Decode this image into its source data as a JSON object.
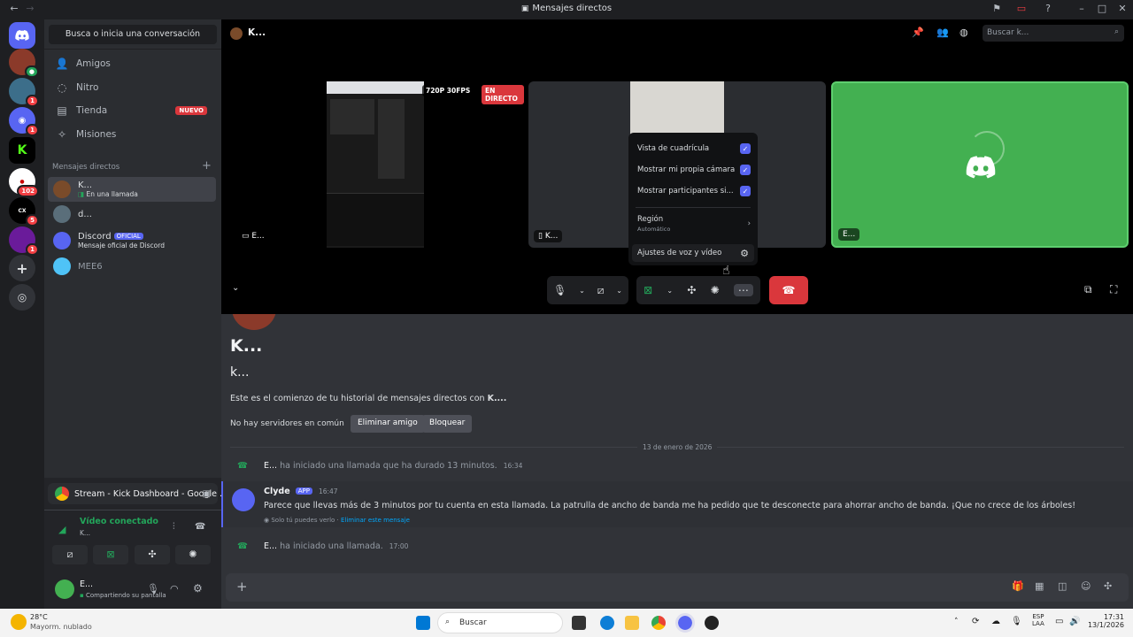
{
  "titlebar": {
    "title": "Mensajes directos"
  },
  "channels": {
    "search_label": "Busca o inicia una conversación",
    "nav": [
      {
        "label": "Amigos",
        "icon": "friends-icon"
      },
      {
        "label": "Nitro",
        "icon": "nitro-icon"
      },
      {
        "label": "Tienda",
        "icon": "shop-icon",
        "badge": "NUEVO"
      },
      {
        "label": "Misiones",
        "icon": "quests-icon"
      }
    ],
    "dm_header": "Mensajes directos",
    "dms": [
      {
        "name": "K...",
        "sub": "En una llamada"
      },
      {
        "name": "d..."
      },
      {
        "name": "Discord",
        "badge": "OFICIAL",
        "sub": "Mensaje oficial de Discord"
      },
      {
        "name": "MEE6"
      }
    ]
  },
  "voice_panel": {
    "stream_title": "Stream - Kick Dashboard - Google ...",
    "connection": "Vídeo conectado",
    "connection_sub": "K...",
    "user_name": "E...",
    "user_status": "Compartiendo su pantalla"
  },
  "header": {
    "channel": "K...",
    "search_placeholder": "Buscar k..."
  },
  "call": {
    "tile1_label": "E...",
    "tile1_quality": "720P 30FPS",
    "tile1_live": "EN DIRECTO",
    "tile2_label": "K...",
    "tile3_label": "E..."
  },
  "menu": {
    "grid": "Vista de cuadrícula",
    "own_camera": "Mostrar mi propia cámara",
    "participants": "Mostrar participantes si...",
    "region": "Región",
    "region_value": "Automático",
    "voice_settings": "Ajustes de voz y vídeo"
  },
  "intro": {
    "big_name": "K...",
    "username": "k...",
    "history_text": "Este es el comienzo de tu historial de mensajes directos con",
    "history_name": "K....",
    "no_servers": "No hay servidores en común",
    "remove_friend": "Eliminar amigo",
    "block": "Bloquear"
  },
  "messages": {
    "date_divider": "13 de enero de 2026",
    "call1_user": "E...",
    "call1_text": "ha iniciado una llamada que ha durado 13 minutos.",
    "call1_time": "16:34",
    "clyde_name": "Clyde",
    "clyde_badge": "APP",
    "clyde_time": "16:47",
    "clyde_text": "Parece que llevas más de 3 minutos por tu cuenta en esta llamada. La patrulla de ancho de banda me ha pedido que te desconecte para ahorrar ancho de banda. ¡Que no crece de los árboles!",
    "clyde_note": "Solo tú puedes verlo ·",
    "clyde_delete": "Eliminar este mensaje",
    "call2_user": "E...",
    "call2_text": "ha iniciado una llamada.",
    "call2_time": "17:00"
  },
  "taskbar": {
    "temp": "28°C",
    "weather": "Mayorm. nublado",
    "search": "Buscar",
    "lang1": "ESP",
    "lang2": "LAA",
    "clock": "17:31",
    "date": "13/1/2026"
  },
  "colors": {
    "accent": "#5865f2",
    "danger": "#da373c",
    "green": "#23a55a",
    "tile_green": "#43b051"
  }
}
